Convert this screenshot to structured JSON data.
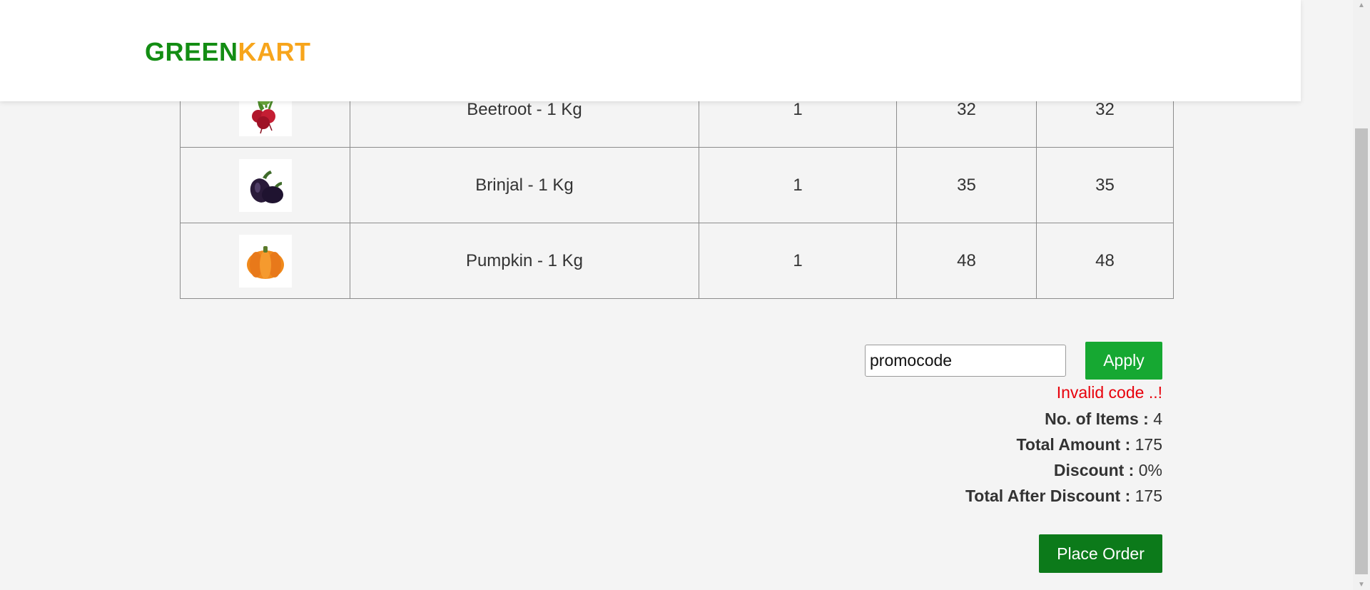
{
  "brand": {
    "part1": "GREEN",
    "part2": "KART"
  },
  "cart": {
    "rows": [
      {
        "name": "Beetroot - 1 Kg",
        "quantity": "1",
        "price": "32",
        "total": "32",
        "image_icon": "beetroot-icon"
      },
      {
        "name": "Brinjal - 1 Kg",
        "quantity": "1",
        "price": "35",
        "total": "35",
        "image_icon": "brinjal-icon"
      },
      {
        "name": "Pumpkin - 1 Kg",
        "quantity": "1",
        "price": "48",
        "total": "48",
        "image_icon": "pumpkin-icon"
      }
    ]
  },
  "promo": {
    "value": "promocode",
    "apply_label": "Apply",
    "error": "Invalid code ..!"
  },
  "summary": {
    "items_label": "No. of Items :",
    "items_value": "4",
    "amount_label": "Total Amount :",
    "amount_value": "175",
    "discount_label": "Discount :",
    "discount_value": "0%",
    "after_label": "Total After Discount :",
    "after_value": "175"
  },
  "place_order_label": "Place Order",
  "colors": {
    "brand_green": "#138d13",
    "brand_orange": "#f7a51c",
    "apply_green": "#16a832",
    "place_order_green": "#0c7a1a",
    "error_red": "#e8000b",
    "background": "#f4f4f4"
  }
}
